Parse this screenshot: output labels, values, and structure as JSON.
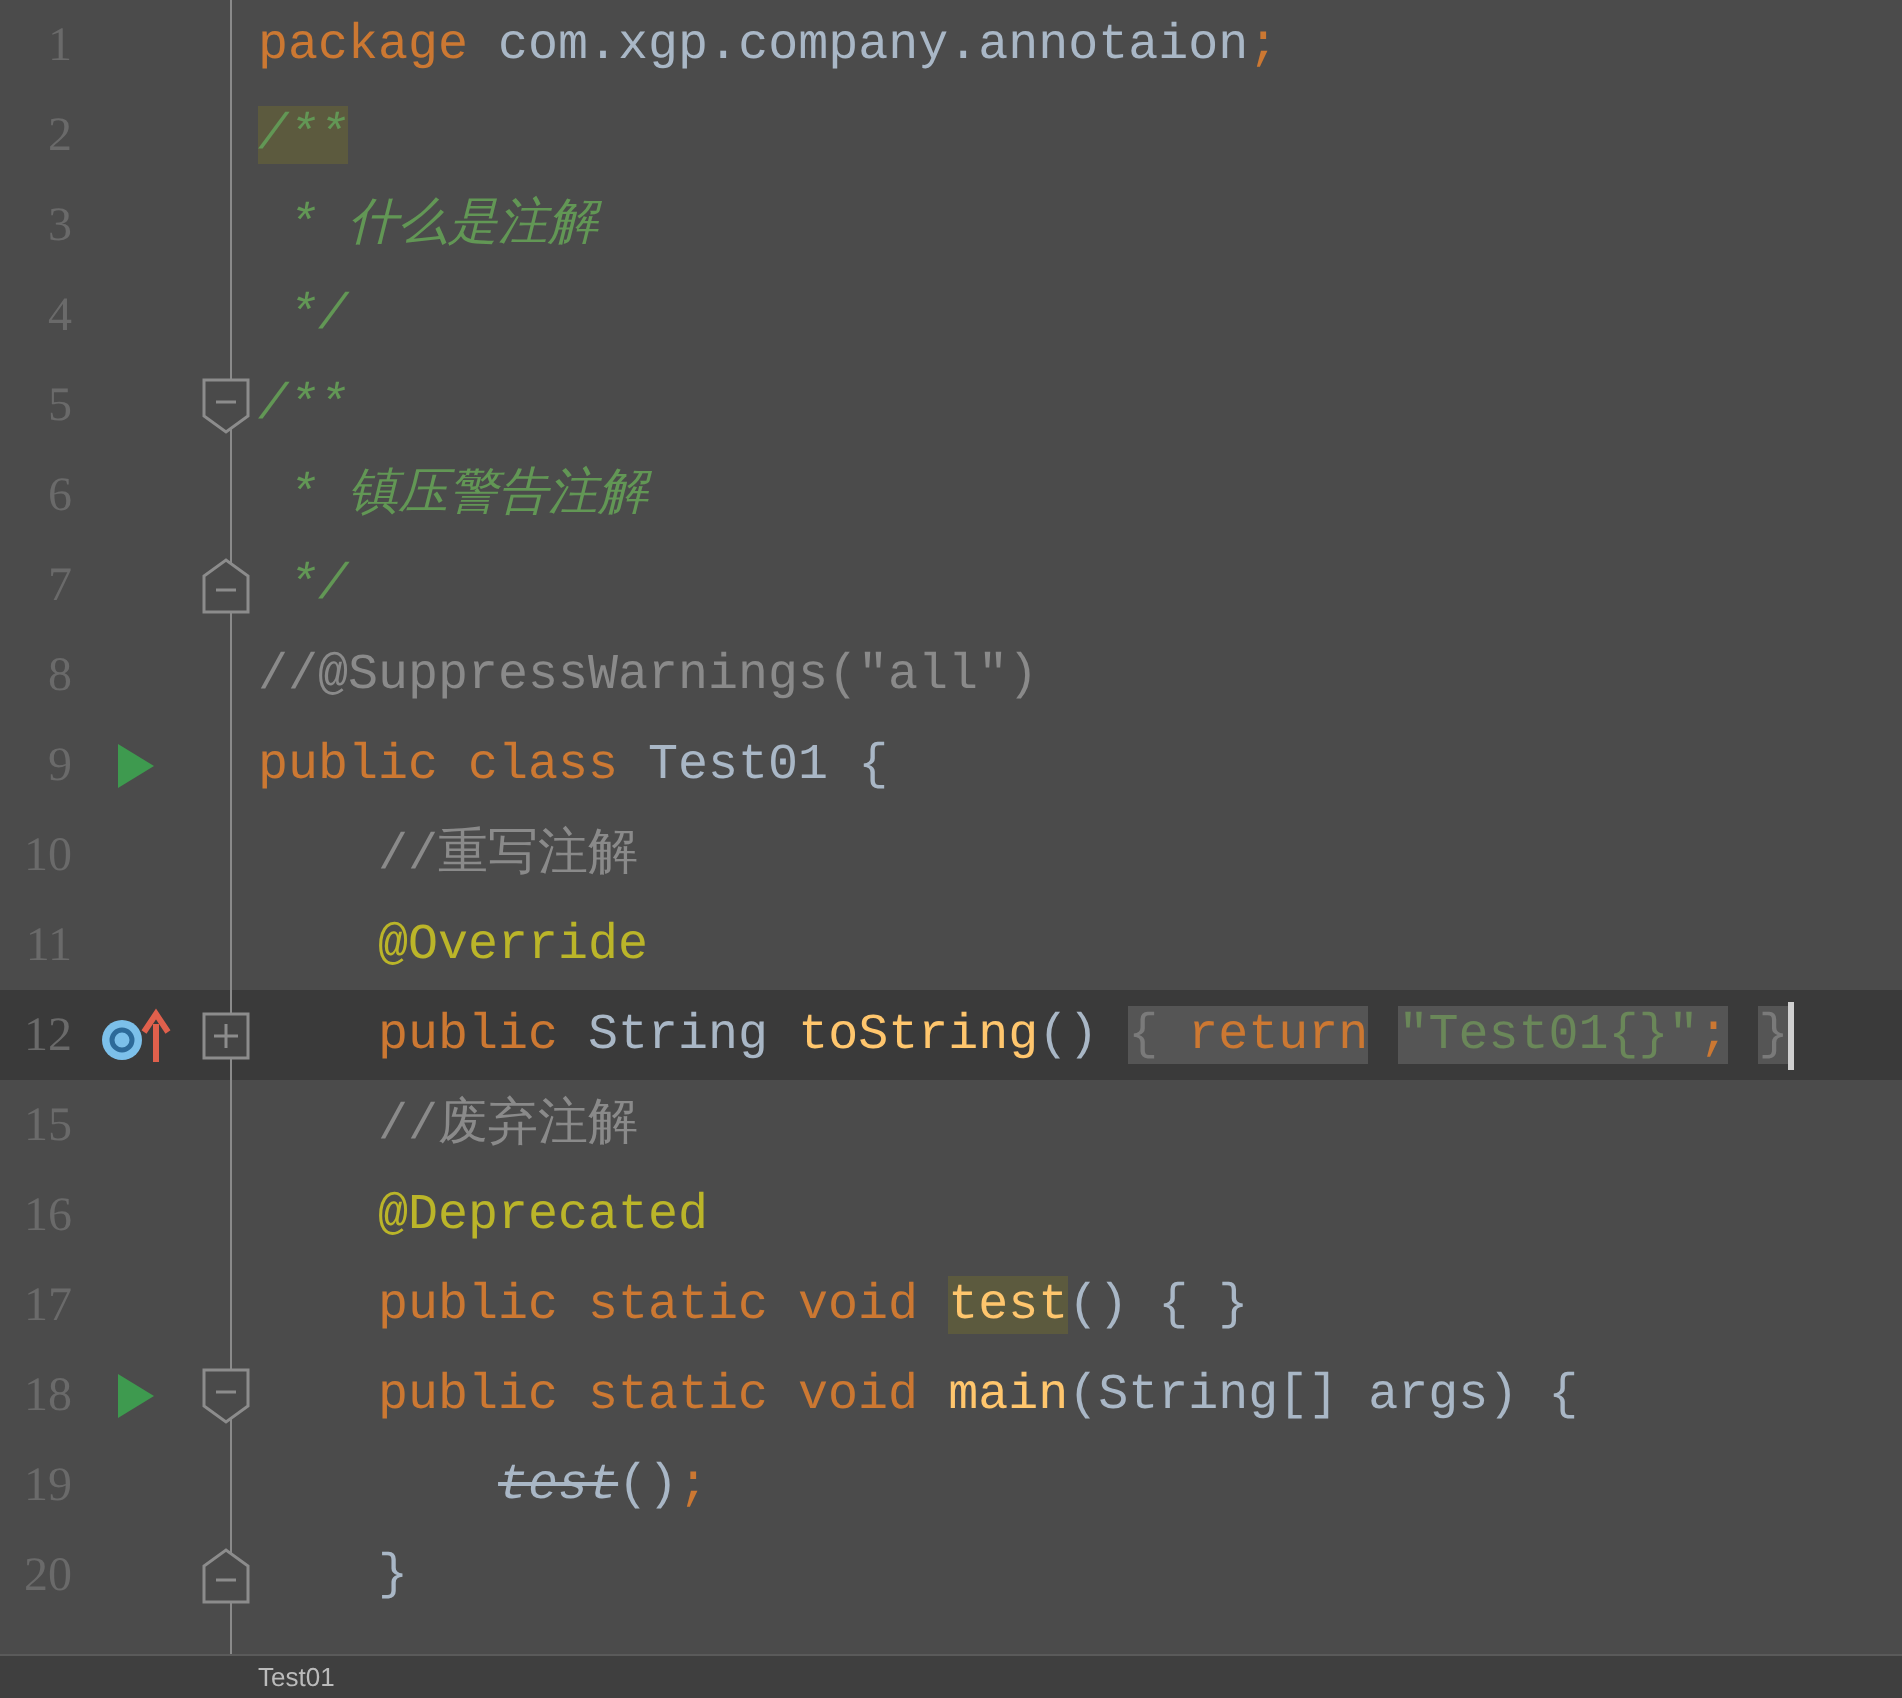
{
  "editor": {
    "lines": [
      {
        "number": "1",
        "current": false,
        "tokens": [
          {
            "text": "package",
            "kind": "keyword"
          },
          {
            "text": " com.xgp.company.annotaion",
            "kind": "plain"
          },
          {
            "text": ";",
            "kind": "punct"
          }
        ]
      },
      {
        "number": "2",
        "current": false,
        "tokens": [
          {
            "text": "/**",
            "kind": "doc",
            "highlighted": true
          }
        ]
      },
      {
        "number": "3",
        "current": false,
        "tokens": [
          {
            "text": " * 什么是注解",
            "kind": "doc"
          }
        ]
      },
      {
        "number": "4",
        "current": false,
        "tokens": [
          {
            "text": " */",
            "kind": "doc"
          }
        ]
      },
      {
        "number": "5",
        "current": false,
        "fold_marker": {
          "kind": "start"
        },
        "tokens": [
          {
            "text": "/**",
            "kind": "doc"
          }
        ]
      },
      {
        "number": "6",
        "current": false,
        "tokens": [
          {
            "text": " * 镇压警告注解",
            "kind": "doc"
          }
        ]
      },
      {
        "number": "7",
        "current": false,
        "fold_marker": {
          "kind": "end"
        },
        "tokens": [
          {
            "text": " */",
            "kind": "doc"
          }
        ]
      },
      {
        "number": "8",
        "current": false,
        "tokens": [
          {
            "text": "//@SuppressWarnings(\"all\")",
            "kind": "comment"
          }
        ]
      },
      {
        "number": "9",
        "current": false,
        "gutter_icon": {
          "kind": "run"
        },
        "tokens": [
          {
            "text": "public class",
            "kind": "keyword"
          },
          {
            "text": " Test01 {",
            "kind": "plain"
          }
        ]
      },
      {
        "number": "10",
        "current": false,
        "tokens": [
          {
            "text": "    //重写注解",
            "kind": "comment"
          }
        ]
      },
      {
        "number": "11",
        "current": false,
        "tokens": [
          {
            "text": "    @Override",
            "kind": "annotation"
          }
        ]
      },
      {
        "number": "12",
        "current": true,
        "gutter_icon": {
          "kind": "override"
        },
        "fold_marker": {
          "kind": "collapsed"
        },
        "caret": true,
        "tokens": [
          {
            "text": "    public",
            "kind": "keyword"
          },
          {
            "text": " String ",
            "kind": "plain"
          },
          {
            "text": "toString",
            "kind": "method"
          },
          {
            "text": "()",
            "kind": "plain"
          },
          {
            "text": " { ",
            "kind": "folded"
          },
          {
            "text": "return",
            "kind": "keyword",
            "folded": true
          },
          {
            "text": " \"Test01{}\"",
            "kind": "string",
            "folded": true
          },
          {
            "text": ";",
            "kind": "punct",
            "folded": true
          },
          {
            "text": " }",
            "kind": "folded"
          }
        ]
      },
      {
        "number": "15",
        "current": false,
        "tokens": [
          {
            "text": "    //废弃注解",
            "kind": "comment"
          }
        ]
      },
      {
        "number": "16",
        "current": false,
        "tokens": [
          {
            "text": "    @Deprecated",
            "kind": "annotation"
          }
        ]
      },
      {
        "number": "17",
        "current": false,
        "tokens": [
          {
            "text": "    public static void",
            "kind": "keyword"
          },
          {
            "text": " test",
            "kind": "method",
            "highlighted": true
          },
          {
            "text": "() { }",
            "kind": "plain"
          }
        ]
      },
      {
        "number": "18",
        "current": false,
        "gutter_icon": {
          "kind": "run"
        },
        "fold_marker": {
          "kind": "start"
        },
        "tokens": [
          {
            "text": "    public static void",
            "kind": "keyword"
          },
          {
            "text": " main",
            "kind": "method"
          },
          {
            "text": "(String[] args) {",
            "kind": "plain"
          }
        ]
      },
      {
        "number": "19",
        "current": false,
        "tokens": [
          {
            "text": "        test",
            "kind": "deprecated"
          },
          {
            "text": "()",
            "kind": "plain"
          },
          {
            "text": ";",
            "kind": "punct"
          }
        ]
      },
      {
        "number": "20",
        "current": false,
        "fold_marker": {
          "kind": "end"
        },
        "tokens": [
          {
            "text": "    }",
            "kind": "plain"
          }
        ]
      }
    ]
  },
  "breadcrumb": {
    "text": "Test01"
  }
}
